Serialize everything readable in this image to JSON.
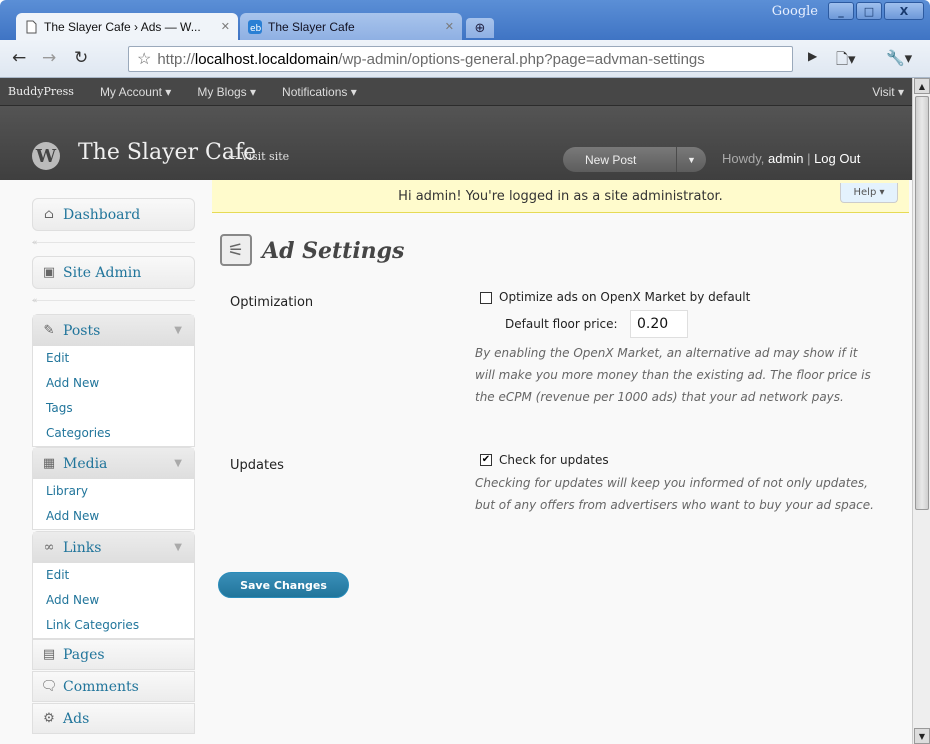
{
  "browser": {
    "brand": "Google",
    "tabs": [
      {
        "label": "The Slayer Cafe › Ads — W...",
        "active": true
      },
      {
        "label": "The Slayer Cafe",
        "active": false
      }
    ],
    "url": {
      "protocol": "http://",
      "host": "localhost.localdomain",
      "path": "/wp-admin/options-general.php?page=advman-settings"
    },
    "window_controls": [
      "_",
      "□",
      "X"
    ]
  },
  "buddypress_bar": {
    "brand": "BuddyPress",
    "items": [
      "My Account ▾",
      "My Blogs ▾",
      "Notifications ▾"
    ],
    "visit": "Visit ▾"
  },
  "wp_header": {
    "site_name": "The Slayer Cafe",
    "visit_site": "← Visit site",
    "new_post": "New Post",
    "howdy_prefix": "Howdy,",
    "username": "admin",
    "separator": "|",
    "logout": "Log Out"
  },
  "sidebar": {
    "dashboard": "Dashboard",
    "site_admin": "Site Admin",
    "posts": {
      "label": "Posts",
      "items": [
        "Edit",
        "Add New",
        "Tags",
        "Categories"
      ]
    },
    "media": {
      "label": "Media",
      "items": [
        "Library",
        "Add New"
      ]
    },
    "links": {
      "label": "Links",
      "items": [
        "Edit",
        "Add New",
        "Link Categories"
      ]
    },
    "pages": "Pages",
    "comments": "Comments",
    "ads": "Ads"
  },
  "main": {
    "notice": "Hi admin! You're logged in as a site administrator.",
    "help": "Help ▾",
    "title": "Ad Settings",
    "optimization": {
      "label": "Optimization",
      "checkbox_label": "Optimize ads on OpenX Market by default",
      "checked": false,
      "floor_label": "Default floor price:",
      "floor_value": "0.20",
      "description": "By enabling the OpenX Market, an alternative ad may show if it will make you more money than the existing ad. The floor price is the eCPM (revenue per 1000 ads) that your ad network pays."
    },
    "updates": {
      "label": "Updates",
      "checkbox_label": "Check for updates",
      "checked": true,
      "description": "Checking for updates will keep you informed of not only updates, but of any offers from advertisers who want to buy your ad space."
    },
    "save_button": "Save Changes"
  }
}
